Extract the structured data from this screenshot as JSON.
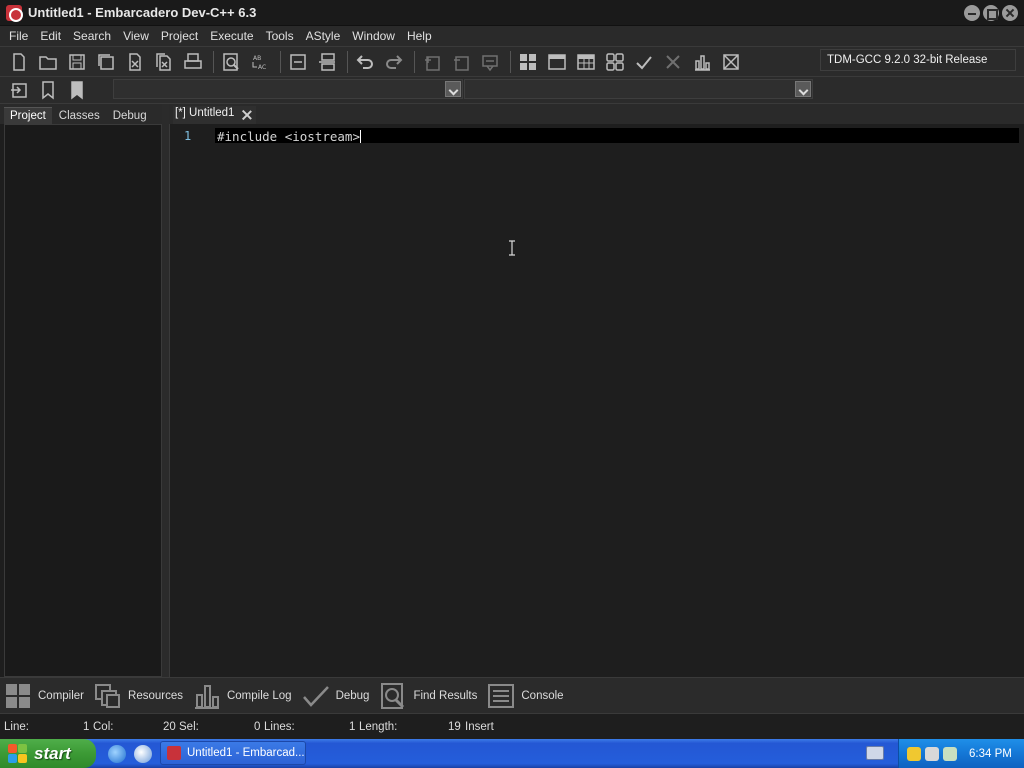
{
  "window": {
    "title": "Untitled1 - Embarcadero Dev-C++ 6.3"
  },
  "menu": [
    "File",
    "Edit",
    "Search",
    "View",
    "Project",
    "Execute",
    "Tools",
    "AStyle",
    "Window",
    "Help"
  ],
  "toolbar": {
    "compiler": "TDM-GCC 9.2.0 32-bit Release"
  },
  "left_panel": {
    "tabs": [
      "Project",
      "Classes",
      "Debug"
    ],
    "active_tab": "Project"
  },
  "editor": {
    "tab_label": "[*] Untitled1",
    "line_number": "1",
    "code": "#include <iostream>"
  },
  "bottom_tabs": [
    "Compiler",
    "Resources",
    "Compile Log",
    "Debug",
    "Find Results",
    "Console"
  ],
  "status": {
    "line_label": "Line:",
    "line_value": "1",
    "col_label": "Col:",
    "col_value": "20",
    "sel_label": "Sel:",
    "sel_value": "0",
    "lines_label": "Lines:",
    "lines_value": "1",
    "length_label": "Length:",
    "length_value": "19",
    "mode": "Insert"
  },
  "taskbar": {
    "start_label": "start",
    "task_label": "Untitled1 - Embarcad...",
    "clock": "6:34 PM"
  },
  "colors": {
    "editor_bg": "#1e1e1e",
    "line_numbers": "#7fbfe0",
    "taskbar": "#245edb",
    "start_green": "#3c9a35"
  }
}
